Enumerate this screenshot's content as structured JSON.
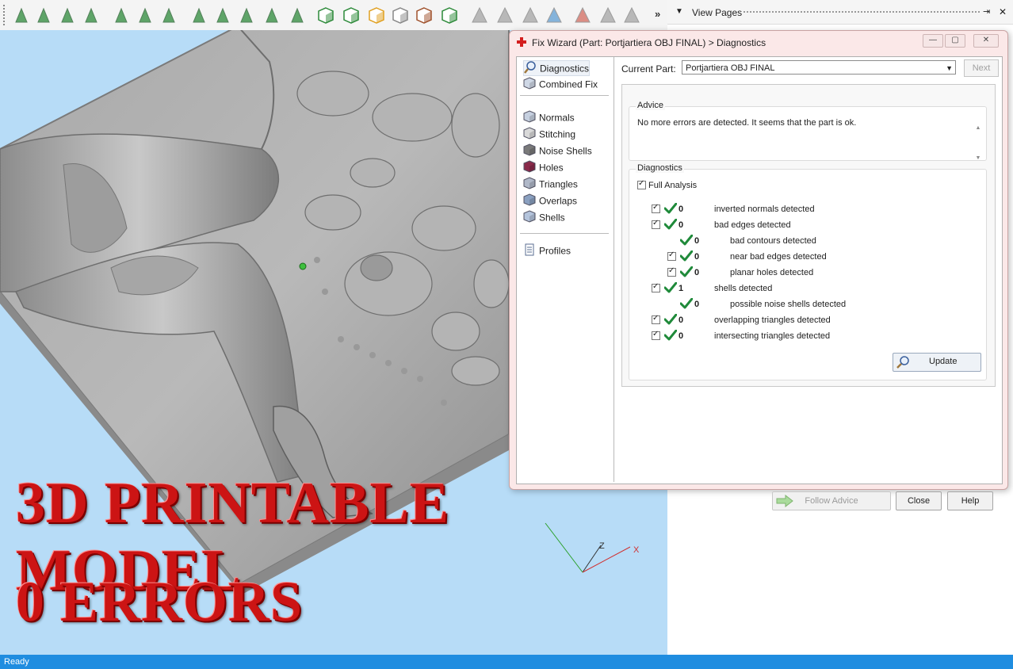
{
  "toolbar": {
    "more_label": "»",
    "icons": [
      "arrow-select-icon",
      "surface-select-icon",
      "edge-select-icon",
      "shell-select-icon",
      "rectangle-select-icon",
      "polyline-select-icon",
      "curve-select-icon",
      "box-select-icon",
      "lasso-select-icon",
      "pattern-select-icon",
      "wheel-select-icon",
      "shell-cut-icon",
      "cube-front-icon",
      "cube-side-icon",
      "cube-color-icon",
      "cube-wire-icon",
      "cube-section-icon",
      "cube-green-icon",
      "arrow-grey-icon",
      "arrow-dark-icon",
      "arrow-cross-icon",
      "arrow-globe-icon",
      "triangle-red-x-icon",
      "triangle-tilt-icon",
      "triangle-plain-icon"
    ]
  },
  "right_panel": {
    "title": "View Pages"
  },
  "viewport": {
    "headline": "3D PRINTABLE MODEL",
    "subline": "0 ERRORS",
    "axis_z": "Z",
    "axis_x": "X"
  },
  "status": {
    "text": "Ready"
  },
  "dialog": {
    "title": "Fix Wizard (Part: Portjartiera OBJ FINAL) > Diagnostics",
    "nav": [
      {
        "label": "Diagnostics",
        "icon": "magnifier-icon"
      },
      {
        "label": "Combined Fix",
        "icon": "cube-icon"
      },
      {
        "label": "Normals",
        "icon": "normals-cube-icon"
      },
      {
        "label": "Stitching",
        "icon": "stitching-cube-icon"
      },
      {
        "label": "Noise Shells",
        "icon": "noise-shells-icon"
      },
      {
        "label": "Holes",
        "icon": "holes-cube-icon"
      },
      {
        "label": "Triangles",
        "icon": "triangles-icon"
      },
      {
        "label": "Overlaps",
        "icon": "overlaps-icon"
      },
      {
        "label": "Shells",
        "icon": "shells-icon"
      },
      {
        "label": "Profiles",
        "icon": "profiles-icon"
      }
    ],
    "current_part_label": "Current Part:",
    "current_part_value": "Portjartiera OBJ FINAL",
    "next_label": "Next",
    "advice_title": "Advice",
    "advice_text": "No more errors are detected. It seems that the part is ok.",
    "diagnostics_title": "Diagnostics",
    "full_analysis_label": "Full Analysis",
    "rows": [
      {
        "count": "0",
        "label": "inverted normals detected"
      },
      {
        "count": "0",
        "label": "bad edges detected"
      },
      {
        "count": "0",
        "label": "bad contours detected"
      },
      {
        "count": "0",
        "label": "near bad edges detected"
      },
      {
        "count": "0",
        "label": "planar holes detected"
      },
      {
        "count": "1",
        "label": "shells detected"
      },
      {
        "count": "0",
        "label": "possible noise shells detected"
      },
      {
        "count": "0",
        "label": "overlapping triangles detected"
      },
      {
        "count": "0",
        "label": "intersecting triangles detected"
      }
    ],
    "update_label": "Update",
    "follow_advice_label": "Follow Advice",
    "close_label": "Close",
    "help_label": "Help"
  }
}
